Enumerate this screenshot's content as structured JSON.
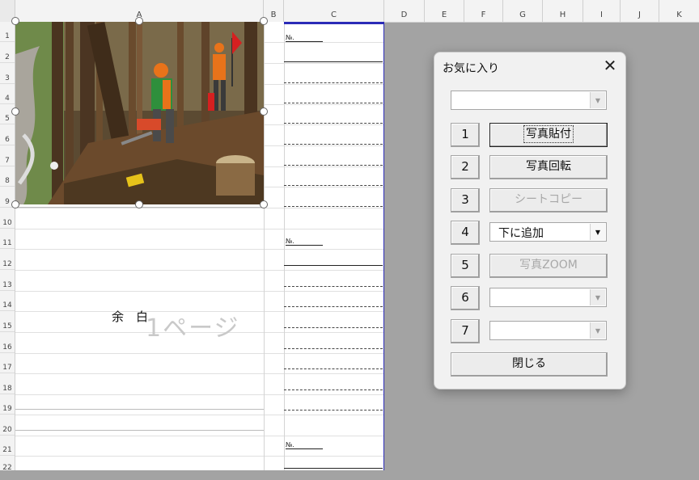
{
  "columns": [
    "A",
    "B",
    "C",
    "D",
    "E",
    "F",
    "G",
    "H",
    "I",
    "J",
    "K"
  ],
  "rows": [
    "1",
    "2",
    "3",
    "4",
    "5",
    "6",
    "7",
    "8",
    "9",
    "10",
    "11",
    "12",
    "13",
    "14",
    "15",
    "16",
    "17",
    "18",
    "19",
    "20",
    "21",
    "22"
  ],
  "sheet": {
    "memo_labels": [
      "№.",
      "№.",
      "№."
    ],
    "blank_label": "余　白",
    "page_label": "1ページ"
  },
  "photo": {
    "description": "Forestry workers with chainsaw in cedar forest"
  },
  "dialog": {
    "title": "お気に入り",
    "close_icon": "close-icon",
    "top_combo_value": "",
    "buttons": [
      {
        "num": "1",
        "label": "写真貼付",
        "state": "focused"
      },
      {
        "num": "2",
        "label": "写真回転",
        "state": "enabled"
      },
      {
        "num": "3",
        "label": "シートコピー",
        "state": "disabled"
      },
      {
        "num": "4",
        "combo_value": "下に追加",
        "state": "combo"
      },
      {
        "num": "5",
        "label": "写真ZOOM",
        "state": "disabled"
      },
      {
        "num": "6",
        "combo_value": "",
        "state": "combo"
      },
      {
        "num": "7",
        "combo_value": "",
        "state": "combo"
      }
    ],
    "close_button": "閉じる"
  },
  "colors": {
    "page_border": "#2b2bb7",
    "dialog_bg": "#f1f1f1",
    "workspace": "#a3a3a3"
  }
}
